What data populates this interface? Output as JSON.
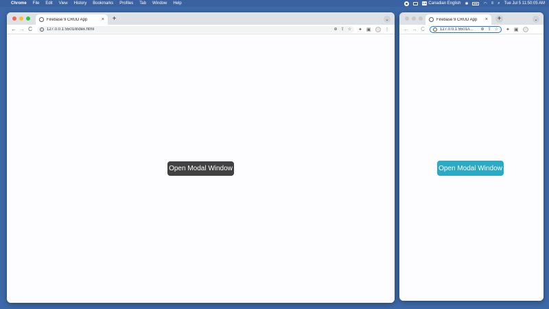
{
  "menubar": {
    "apple_glyph": "",
    "items": [
      "Chrome",
      "File",
      "Edit",
      "View",
      "History",
      "Bookmarks",
      "Profiles",
      "Tab",
      "Window",
      "Help"
    ],
    "keyboard_badge": "CA",
    "keyboard_layout": "Canadian English",
    "datetime": "Tue Jul 5  11:50:05 AM"
  },
  "left_window": {
    "tab_title": "Firebase 9 CRUD App",
    "url": "127.0.0.1:5501/index.html",
    "button_label": "Open Modal Window",
    "button_color": "#414141"
  },
  "right_window": {
    "tab_title": "Firebase 9 CRUD App",
    "url": "127.0.0.1:5501/i...",
    "button_label": "Open Modal Window",
    "button_color": "#2aaac4"
  },
  "icons": {
    "close": "×",
    "new_tab": "+",
    "tab_menu": "⌄",
    "back": "←",
    "forward": "→",
    "reload": "C",
    "zoom": "⊕",
    "share": "⇪",
    "bookmark": "☆",
    "extensions": "✦",
    "sidebar": "▣",
    "more": "⋮",
    "info": "i"
  }
}
